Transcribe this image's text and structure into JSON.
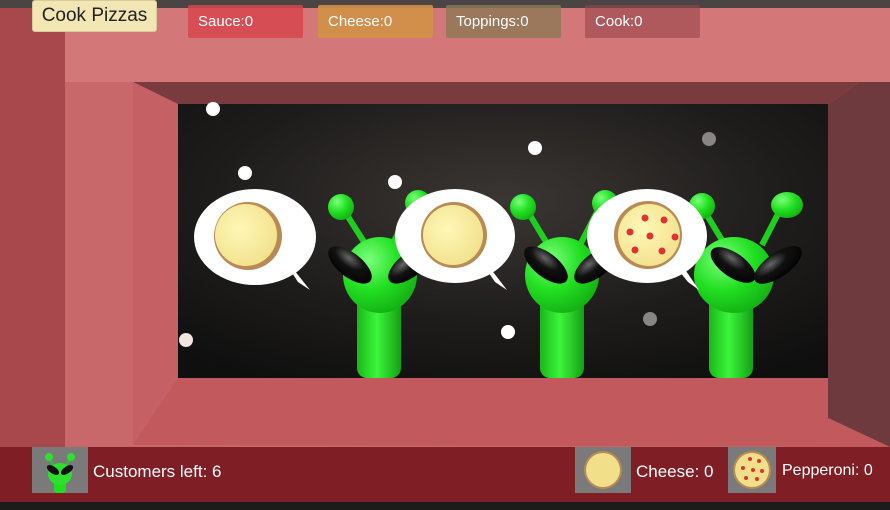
{
  "top_bar": {
    "cook_button": "Cook Pizzas",
    "sauce": "Sauce:0",
    "cheese": "Cheese:0",
    "toppings": "Toppings:0",
    "cook": "Cook:0"
  },
  "scene": {
    "aliens": [
      {
        "order": "cheese pizza"
      },
      {
        "order": "cheese pizza"
      },
      {
        "order": "pepperoni pizza"
      }
    ]
  },
  "bottom_bar": {
    "customers_label": "Customers left:",
    "customers_value": "6",
    "customers_text": "Customers left: 6",
    "cheese_text": "Cheese: 0",
    "pepperoni_text": "Pepperoni: 0"
  },
  "colors": {
    "wall": "#c45c5e",
    "alien_green": "#22dd22",
    "space": "#111111",
    "bar": "#7f1e24"
  }
}
